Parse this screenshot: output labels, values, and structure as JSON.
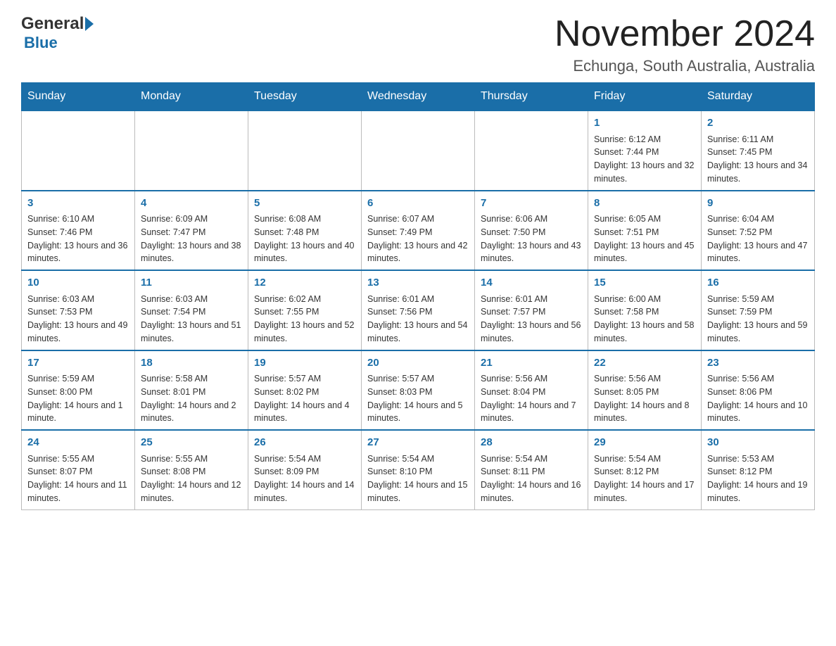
{
  "header": {
    "logo_general": "General",
    "logo_blue": "Blue",
    "month_title": "November 2024",
    "location": "Echunga, South Australia, Australia"
  },
  "weekdays": [
    "Sunday",
    "Monday",
    "Tuesday",
    "Wednesday",
    "Thursday",
    "Friday",
    "Saturday"
  ],
  "weeks": [
    [
      {
        "day": "",
        "sunrise": "",
        "sunset": "",
        "daylight": ""
      },
      {
        "day": "",
        "sunrise": "",
        "sunset": "",
        "daylight": ""
      },
      {
        "day": "",
        "sunrise": "",
        "sunset": "",
        "daylight": ""
      },
      {
        "day": "",
        "sunrise": "",
        "sunset": "",
        "daylight": ""
      },
      {
        "day": "",
        "sunrise": "",
        "sunset": "",
        "daylight": ""
      },
      {
        "day": "1",
        "sunrise": "Sunrise: 6:12 AM",
        "sunset": "Sunset: 7:44 PM",
        "daylight": "Daylight: 13 hours and 32 minutes."
      },
      {
        "day": "2",
        "sunrise": "Sunrise: 6:11 AM",
        "sunset": "Sunset: 7:45 PM",
        "daylight": "Daylight: 13 hours and 34 minutes."
      }
    ],
    [
      {
        "day": "3",
        "sunrise": "Sunrise: 6:10 AM",
        "sunset": "Sunset: 7:46 PM",
        "daylight": "Daylight: 13 hours and 36 minutes."
      },
      {
        "day": "4",
        "sunrise": "Sunrise: 6:09 AM",
        "sunset": "Sunset: 7:47 PM",
        "daylight": "Daylight: 13 hours and 38 minutes."
      },
      {
        "day": "5",
        "sunrise": "Sunrise: 6:08 AM",
        "sunset": "Sunset: 7:48 PM",
        "daylight": "Daylight: 13 hours and 40 minutes."
      },
      {
        "day": "6",
        "sunrise": "Sunrise: 6:07 AM",
        "sunset": "Sunset: 7:49 PM",
        "daylight": "Daylight: 13 hours and 42 minutes."
      },
      {
        "day": "7",
        "sunrise": "Sunrise: 6:06 AM",
        "sunset": "Sunset: 7:50 PM",
        "daylight": "Daylight: 13 hours and 43 minutes."
      },
      {
        "day": "8",
        "sunrise": "Sunrise: 6:05 AM",
        "sunset": "Sunset: 7:51 PM",
        "daylight": "Daylight: 13 hours and 45 minutes."
      },
      {
        "day": "9",
        "sunrise": "Sunrise: 6:04 AM",
        "sunset": "Sunset: 7:52 PM",
        "daylight": "Daylight: 13 hours and 47 minutes."
      }
    ],
    [
      {
        "day": "10",
        "sunrise": "Sunrise: 6:03 AM",
        "sunset": "Sunset: 7:53 PM",
        "daylight": "Daylight: 13 hours and 49 minutes."
      },
      {
        "day": "11",
        "sunrise": "Sunrise: 6:03 AM",
        "sunset": "Sunset: 7:54 PM",
        "daylight": "Daylight: 13 hours and 51 minutes."
      },
      {
        "day": "12",
        "sunrise": "Sunrise: 6:02 AM",
        "sunset": "Sunset: 7:55 PM",
        "daylight": "Daylight: 13 hours and 52 minutes."
      },
      {
        "day": "13",
        "sunrise": "Sunrise: 6:01 AM",
        "sunset": "Sunset: 7:56 PM",
        "daylight": "Daylight: 13 hours and 54 minutes."
      },
      {
        "day": "14",
        "sunrise": "Sunrise: 6:01 AM",
        "sunset": "Sunset: 7:57 PM",
        "daylight": "Daylight: 13 hours and 56 minutes."
      },
      {
        "day": "15",
        "sunrise": "Sunrise: 6:00 AM",
        "sunset": "Sunset: 7:58 PM",
        "daylight": "Daylight: 13 hours and 58 minutes."
      },
      {
        "day": "16",
        "sunrise": "Sunrise: 5:59 AM",
        "sunset": "Sunset: 7:59 PM",
        "daylight": "Daylight: 13 hours and 59 minutes."
      }
    ],
    [
      {
        "day": "17",
        "sunrise": "Sunrise: 5:59 AM",
        "sunset": "Sunset: 8:00 PM",
        "daylight": "Daylight: 14 hours and 1 minute."
      },
      {
        "day": "18",
        "sunrise": "Sunrise: 5:58 AM",
        "sunset": "Sunset: 8:01 PM",
        "daylight": "Daylight: 14 hours and 2 minutes."
      },
      {
        "day": "19",
        "sunrise": "Sunrise: 5:57 AM",
        "sunset": "Sunset: 8:02 PM",
        "daylight": "Daylight: 14 hours and 4 minutes."
      },
      {
        "day": "20",
        "sunrise": "Sunrise: 5:57 AM",
        "sunset": "Sunset: 8:03 PM",
        "daylight": "Daylight: 14 hours and 5 minutes."
      },
      {
        "day": "21",
        "sunrise": "Sunrise: 5:56 AM",
        "sunset": "Sunset: 8:04 PM",
        "daylight": "Daylight: 14 hours and 7 minutes."
      },
      {
        "day": "22",
        "sunrise": "Sunrise: 5:56 AM",
        "sunset": "Sunset: 8:05 PM",
        "daylight": "Daylight: 14 hours and 8 minutes."
      },
      {
        "day": "23",
        "sunrise": "Sunrise: 5:56 AM",
        "sunset": "Sunset: 8:06 PM",
        "daylight": "Daylight: 14 hours and 10 minutes."
      }
    ],
    [
      {
        "day": "24",
        "sunrise": "Sunrise: 5:55 AM",
        "sunset": "Sunset: 8:07 PM",
        "daylight": "Daylight: 14 hours and 11 minutes."
      },
      {
        "day": "25",
        "sunrise": "Sunrise: 5:55 AM",
        "sunset": "Sunset: 8:08 PM",
        "daylight": "Daylight: 14 hours and 12 minutes."
      },
      {
        "day": "26",
        "sunrise": "Sunrise: 5:54 AM",
        "sunset": "Sunset: 8:09 PM",
        "daylight": "Daylight: 14 hours and 14 minutes."
      },
      {
        "day": "27",
        "sunrise": "Sunrise: 5:54 AM",
        "sunset": "Sunset: 8:10 PM",
        "daylight": "Daylight: 14 hours and 15 minutes."
      },
      {
        "day": "28",
        "sunrise": "Sunrise: 5:54 AM",
        "sunset": "Sunset: 8:11 PM",
        "daylight": "Daylight: 14 hours and 16 minutes."
      },
      {
        "day": "29",
        "sunrise": "Sunrise: 5:54 AM",
        "sunset": "Sunset: 8:12 PM",
        "daylight": "Daylight: 14 hours and 17 minutes."
      },
      {
        "day": "30",
        "sunrise": "Sunrise: 5:53 AM",
        "sunset": "Sunset: 8:12 PM",
        "daylight": "Daylight: 14 hours and 19 minutes."
      }
    ]
  ]
}
